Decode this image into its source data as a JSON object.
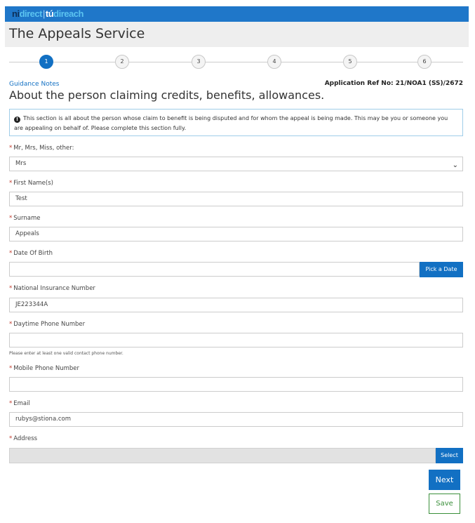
{
  "logo": {
    "part1": "ni",
    "part2": "direct",
    "separator": "|",
    "part3": "tú",
    "part4": "direach"
  },
  "app_title": "The Appeals Service",
  "steps": [
    "1",
    "2",
    "3",
    "4",
    "5",
    "6"
  ],
  "active_step": 1,
  "guidance_link": "Guidance Notes",
  "application_ref": "Application Ref No: 21/NOA1 (SS)/2672",
  "section_heading": "About the person claiming credits, benefits, allowances.",
  "info_text": "This section is all about the person whose claim to benefit is being disputed and for whom the appeal is being made. This may be you or someone you are appealing on behalf of. Please complete this section fully.",
  "form": {
    "title_label": "Mr, Mrs, Miss, other:",
    "title_value": "Mrs",
    "first_name_label": "First Name(s)",
    "first_name_value": "Test",
    "surname_label": "Surname",
    "surname_value": "Appeals",
    "dob_label": "Date Of Birth",
    "dob_value": "",
    "pick_date_label": "Pick a Date",
    "ni_label": "National Insurance Number",
    "ni_value": "JE223344A",
    "daytime_phone_label": "Daytime Phone Number",
    "daytime_phone_value": "",
    "phone_hint": "Please enter at least one valid contact phone number.",
    "mobile_label": "Mobile Phone Number",
    "mobile_value": "",
    "email_label": "Email",
    "email_value": "rubys@stiona.com",
    "address_label": "Address",
    "select_label": "Select",
    "required_marker": "*"
  },
  "buttons": {
    "next": "Next",
    "save": "Save"
  },
  "colors": {
    "primary": "#1270c3",
    "save_green": "#3a8f3a",
    "required": "#c0392b"
  }
}
